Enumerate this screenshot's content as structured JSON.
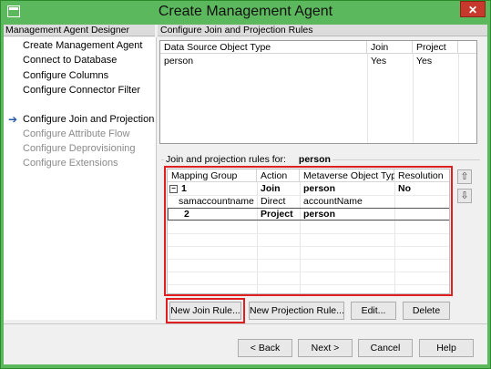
{
  "window": {
    "title": "Create Management Agent",
    "close_glyph": "✕"
  },
  "designer": {
    "header": "Management Agent Designer",
    "items": [
      {
        "label": "Create Management Agent",
        "enabled": true,
        "current": false
      },
      {
        "label": "Connect to Database",
        "enabled": true,
        "current": false
      },
      {
        "label": "Configure Columns",
        "enabled": true,
        "current": false
      },
      {
        "label": "Configure Connector Filter",
        "enabled": true,
        "current": false
      },
      {
        "label": "Configure Join and Projection Rules",
        "enabled": true,
        "current": true
      },
      {
        "label": "Configure Attribute Flow",
        "enabled": false,
        "current": false
      },
      {
        "label": "Configure Deprovisioning",
        "enabled": false,
        "current": false
      },
      {
        "label": "Configure Extensions",
        "enabled": false,
        "current": false
      }
    ],
    "current_arrow": "➔"
  },
  "page": {
    "header": "Configure Join and Projection Rules",
    "object_types": {
      "columns": [
        "Data Source Object Type",
        "Join",
        "Project"
      ],
      "rows": [
        {
          "type": "person",
          "join": "Yes",
          "project": "Yes"
        }
      ]
    },
    "rules_label": "Join and projection rules for:",
    "rules_object": "person",
    "rules": {
      "columns": [
        "Mapping Group",
        "Action",
        "Metaverse Object Type",
        "Resolution"
      ],
      "groups": [
        {
          "group": "1",
          "action": "Join",
          "mv_type": "person",
          "resolution": "No",
          "expand_glyph": "−",
          "mapping": {
            "source": "samaccountname",
            "method": "Direct",
            "target": "accountName"
          }
        },
        {
          "group": "2",
          "action": "Project",
          "mv_type": "person",
          "resolution": ""
        }
      ]
    },
    "move_up_glyph": "⇧",
    "move_down_glyph": "⇩",
    "buttons": {
      "new_join": "New Join Rule...",
      "new_projection": "New Projection Rule...",
      "edit": "Edit...",
      "delete": "Delete"
    }
  },
  "footer": {
    "back": "< Back",
    "next": "Next >",
    "cancel": "Cancel",
    "help": "Help"
  },
  "colors": {
    "title_bar": "#5cb85c",
    "highlight": "#e02020",
    "nav_arrow": "#2a58a8"
  }
}
